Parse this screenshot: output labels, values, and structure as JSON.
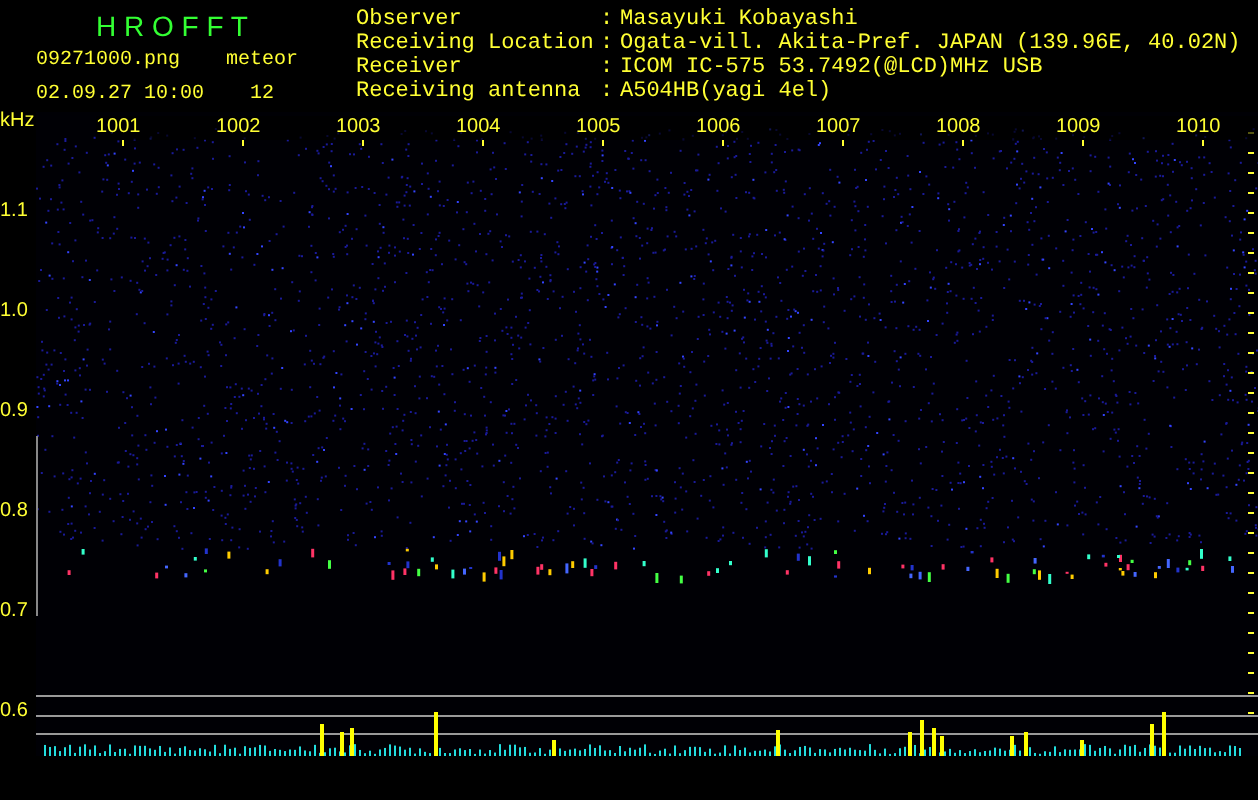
{
  "app": {
    "title": "H R O F F T",
    "filename": "09271000.png",
    "datetime": "02.09.27 10:00",
    "meteor_label": "meteor",
    "meteor_count": "12"
  },
  "info": [
    {
      "label": "Observer",
      "separator": ":",
      "value": "Masayuki Kobayashi"
    },
    {
      "label": "Receiving Location",
      "separator": ":",
      "value": "Ogata-vill. Akita-Pref. JAPAN (139.96E, 40.02N)"
    },
    {
      "label": "Receiver",
      "separator": ":",
      "value": "ICOM IC-575 53.7492(@LCD)MHz USB"
    },
    {
      "label": "Receiving antenna",
      "separator": ":",
      "value": "A504HB(yagi 4el)"
    }
  ],
  "spectrogram": {
    "unit": "kHz",
    "x_labels": [
      "1001",
      "1002",
      "1003",
      "1004",
      "1005",
      "1006",
      "1007",
      "1008",
      "1009",
      "1010"
    ],
    "y_labels": [
      "1.1",
      "1.0",
      "0.9",
      "0.8",
      "0.7",
      "0.6"
    ]
  }
}
